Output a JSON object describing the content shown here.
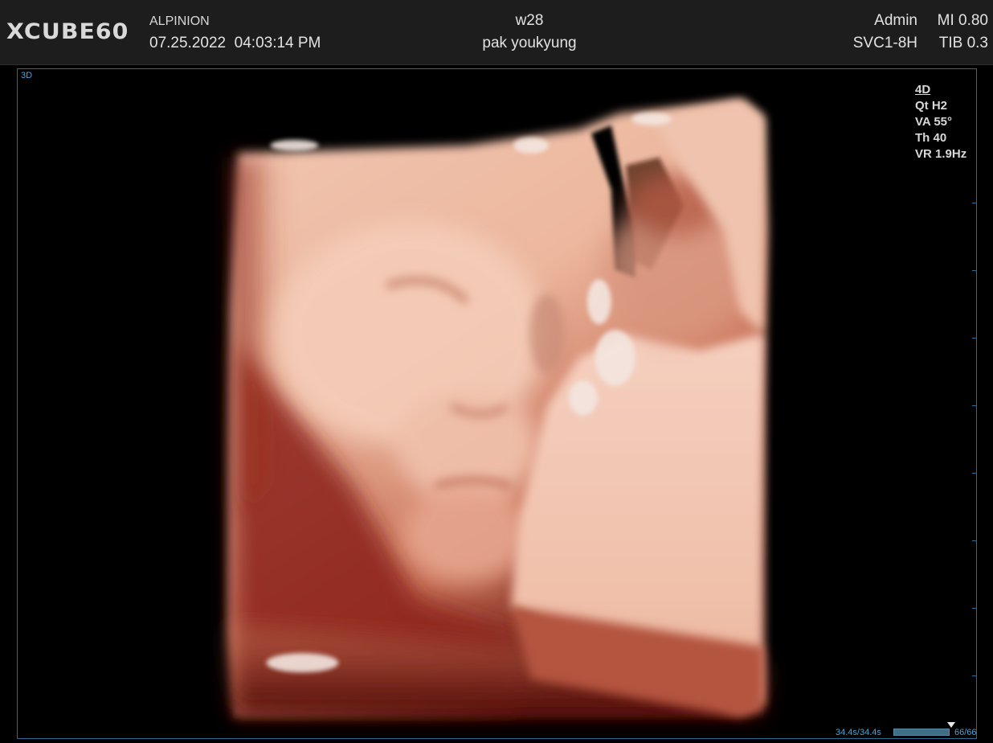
{
  "header": {
    "logo": "XCUBE60",
    "hospital": "ALPINION",
    "datetime": "07.25.2022  04:03:14 PM",
    "gestation": "w28",
    "patient": "pak youkyung",
    "user": "Admin",
    "probe": "SVC1-8H",
    "mi": "MI 0.80",
    "tib": "TIB 0.3"
  },
  "viewport": {
    "mode": "3D",
    "params": [
      "4D",
      "Qt H2",
      "VA 55°",
      "Th 40",
      "VR 1.9Hz"
    ],
    "accent_color": "#2b6b93"
  },
  "cine": {
    "time": "34.4s/34.4s",
    "frames": "66/66",
    "progress": 1.0
  },
  "image": {
    "subject": "3d-rendered-fetal-face",
    "palette": [
      "#f0c2ad",
      "#d9836a",
      "#8a1c14",
      "#2a0302"
    ]
  }
}
